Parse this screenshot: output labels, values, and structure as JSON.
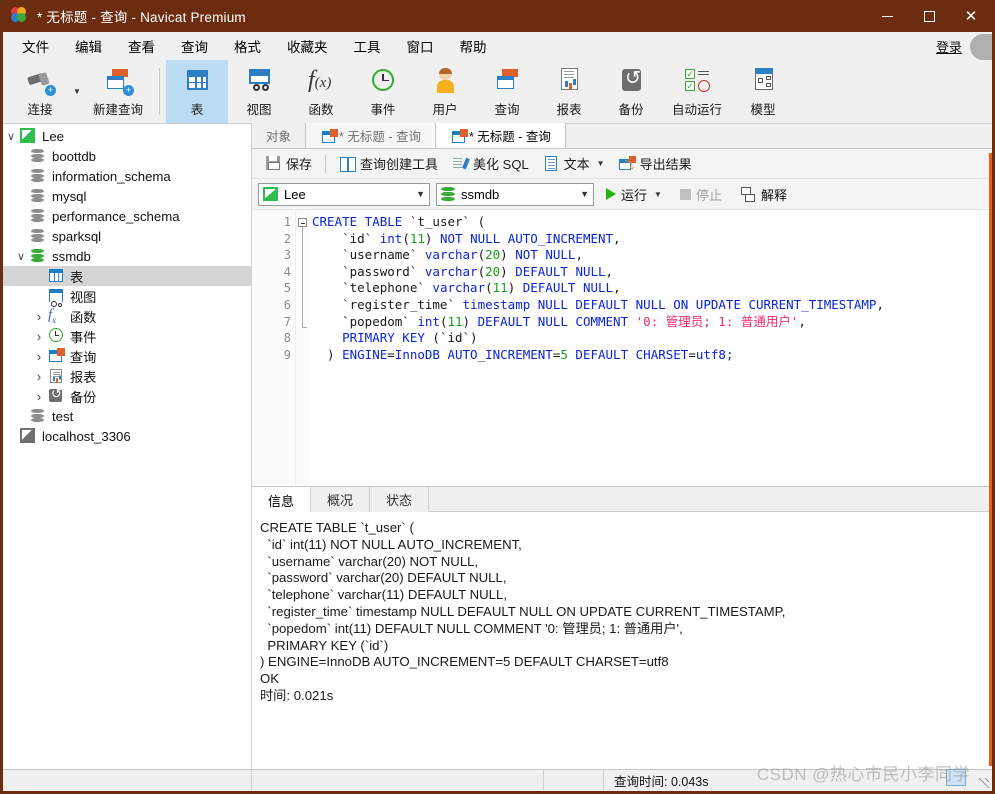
{
  "window": {
    "title": "* 无标题 - 查询 - Navicat Premium",
    "minimize": "–",
    "maximize": "□",
    "close": "✕"
  },
  "menubar": {
    "items": [
      "文件",
      "编辑",
      "查看",
      "查询",
      "格式",
      "收藏夹",
      "工具",
      "窗口",
      "帮助"
    ],
    "login": "登录"
  },
  "toolbar": {
    "items": [
      {
        "label": "连接",
        "icon": "plug-icon",
        "has_dropdown": true
      },
      {
        "label": "新建查询",
        "icon": "new-query-icon",
        "has_dropdown": false
      },
      {
        "label": "表",
        "icon": "table-icon",
        "selected": true
      },
      {
        "label": "视图",
        "icon": "view-icon"
      },
      {
        "label": "函数",
        "icon": "function-icon"
      },
      {
        "label": "事件",
        "icon": "event-clock-icon"
      },
      {
        "label": "用户",
        "icon": "user-icon"
      },
      {
        "label": "查询",
        "icon": "query-doc-icon"
      },
      {
        "label": "报表",
        "icon": "report-icon"
      },
      {
        "label": "备份",
        "icon": "backup-icon"
      },
      {
        "label": "自动运行",
        "icon": "automation-icon"
      },
      {
        "label": "模型",
        "icon": "model-icon"
      }
    ]
  },
  "sidebar": {
    "nodes": [
      {
        "label": "Lee",
        "indent": 0,
        "chevron": "down",
        "icon": "connection-green-icon"
      },
      {
        "label": "boottdb",
        "indent": 1,
        "chevron": "none",
        "icon": "database-gray-icon"
      },
      {
        "label": "information_schema",
        "indent": 1,
        "chevron": "none",
        "icon": "database-gray-icon"
      },
      {
        "label": "mysql",
        "indent": 1,
        "chevron": "none",
        "icon": "database-gray-icon"
      },
      {
        "label": "performance_schema",
        "indent": 1,
        "chevron": "none",
        "icon": "database-gray-icon"
      },
      {
        "label": "sparksql",
        "indent": 1,
        "chevron": "none",
        "icon": "database-gray-icon"
      },
      {
        "label": "ssmdb",
        "indent": 1,
        "chevron": "down",
        "icon": "database-green-icon"
      },
      {
        "label": "表",
        "indent": 2,
        "chevron": "none",
        "icon": "table-icon",
        "selected": true
      },
      {
        "label": "视图",
        "indent": 2,
        "chevron": "none",
        "icon": "view-icon"
      },
      {
        "label": "函数",
        "indent": 2,
        "chevron": "right",
        "icon": "function-icon"
      },
      {
        "label": "事件",
        "indent": 2,
        "chevron": "right",
        "icon": "event-clock-icon"
      },
      {
        "label": "查询",
        "indent": 2,
        "chevron": "right",
        "icon": "query-doc-icon"
      },
      {
        "label": "报表",
        "indent": 2,
        "chevron": "right",
        "icon": "report-icon"
      },
      {
        "label": "备份",
        "indent": 2,
        "chevron": "right",
        "icon": "backup-icon"
      },
      {
        "label": "test",
        "indent": 1,
        "chevron": "none",
        "icon": "database-gray-icon"
      },
      {
        "label": "localhost_3306",
        "indent": 0,
        "chevron": "none",
        "icon": "connection-gray-icon"
      }
    ]
  },
  "tabs": [
    {
      "label": "对象",
      "active": false,
      "has_icon": false
    },
    {
      "label": "* 无标题 - 查询",
      "active": false,
      "has_icon": true
    },
    {
      "label": "* 无标题 - 查询",
      "active": true,
      "has_icon": true
    }
  ],
  "query_toolbar": {
    "save": "保存",
    "query_builder": "查询创建工具",
    "beautify_sql": "美化 SQL",
    "text": "文本",
    "export_result": "导出结果"
  },
  "query_bar": {
    "connection": "Lee",
    "database": "ssmdb",
    "run": "运行",
    "stop": "停止",
    "explain": "解释"
  },
  "editor": {
    "line_numbers": [
      "1",
      "2",
      "3",
      "4",
      "5",
      "6",
      "7",
      "8",
      "9"
    ],
    "lines": [
      [
        {
          "t": "CREATE TABLE ",
          "c": "k"
        },
        {
          "t": "`t_user`",
          "c": "id"
        },
        {
          "t": " (",
          "c": "pl"
        }
      ],
      [
        {
          "t": "    `id` ",
          "c": "id"
        },
        {
          "t": "int",
          "c": "k"
        },
        {
          "t": "(",
          "c": "pl"
        },
        {
          "t": "11",
          "c": "n"
        },
        {
          "t": ") ",
          "c": "pl"
        },
        {
          "t": "NOT NULL AUTO_INCREMENT",
          "c": "k"
        },
        {
          "t": ",",
          "c": "pl"
        }
      ],
      [
        {
          "t": "    `username` ",
          "c": "id"
        },
        {
          "t": "varchar",
          "c": "k"
        },
        {
          "t": "(",
          "c": "pl"
        },
        {
          "t": "20",
          "c": "n"
        },
        {
          "t": ") ",
          "c": "pl"
        },
        {
          "t": "NOT NULL",
          "c": "k"
        },
        {
          "t": ",",
          "c": "pl"
        }
      ],
      [
        {
          "t": "    `password` ",
          "c": "id"
        },
        {
          "t": "varchar",
          "c": "k"
        },
        {
          "t": "(",
          "c": "pl"
        },
        {
          "t": "20",
          "c": "n"
        },
        {
          "t": ") ",
          "c": "pl"
        },
        {
          "t": "DEFAULT NULL",
          "c": "k"
        },
        {
          "t": ",",
          "c": "pl"
        }
      ],
      [
        {
          "t": "    `telephone` ",
          "c": "id"
        },
        {
          "t": "varchar",
          "c": "k"
        },
        {
          "t": "(",
          "c": "pl"
        },
        {
          "t": "11",
          "c": "n"
        },
        {
          "t": ") ",
          "c": "pl"
        },
        {
          "t": "DEFAULT NULL",
          "c": "k"
        },
        {
          "t": ",",
          "c": "pl"
        }
      ],
      [
        {
          "t": "    `register_time` ",
          "c": "id"
        },
        {
          "t": "timestamp NULL DEFAULT NULL ON UPDATE CURRENT_TIMESTAMP",
          "c": "k"
        },
        {
          "t": ",",
          "c": "pl"
        }
      ],
      [
        {
          "t": "    `popedom` ",
          "c": "id"
        },
        {
          "t": "int",
          "c": "k"
        },
        {
          "t": "(",
          "c": "pl"
        },
        {
          "t": "11",
          "c": "n"
        },
        {
          "t": ") ",
          "c": "pl"
        },
        {
          "t": "DEFAULT NULL COMMENT ",
          "c": "k"
        },
        {
          "t": "'0: 管理员; 1: 普通用户'",
          "c": "s"
        },
        {
          "t": ",",
          "c": "pl"
        }
      ],
      [
        {
          "t": "    PRIMARY KEY ",
          "c": "k"
        },
        {
          "t": "(`id`)",
          "c": "id"
        }
      ],
      [
        {
          "t": "  ) ",
          "c": "pl"
        },
        {
          "t": "ENGINE",
          "c": "k"
        },
        {
          "t": "=",
          "c": "pl"
        },
        {
          "t": "InnoDB AUTO_INCREMENT",
          "c": "k"
        },
        {
          "t": "=",
          "c": "pl"
        },
        {
          "t": "5",
          "c": "n"
        },
        {
          "t": " DEFAULT CHARSET",
          "c": "k"
        },
        {
          "t": "=",
          "c": "pl"
        },
        {
          "t": "utf8;",
          "c": "k"
        }
      ]
    ]
  },
  "results": {
    "tabs": [
      {
        "label": "信息",
        "active": true
      },
      {
        "label": "概况",
        "active": false
      },
      {
        "label": "状态",
        "active": false
      }
    ],
    "message_lines": [
      "CREATE TABLE `t_user` (",
      "  `id` int(11) NOT NULL AUTO_INCREMENT,",
      "  `username` varchar(20) NOT NULL,",
      "  `password` varchar(20) DEFAULT NULL,",
      "  `telephone` varchar(11) DEFAULT NULL,",
      "  `register_time` timestamp NULL DEFAULT NULL ON UPDATE CURRENT_TIMESTAMP,",
      "  `popedom` int(11) DEFAULT NULL COMMENT '0: 管理员; 1: 普通用户',",
      "  PRIMARY KEY (`id`)",
      ") ENGINE=InnoDB AUTO_INCREMENT=5 DEFAULT CHARSET=utf8",
      "OK",
      "时间: 0.021s"
    ]
  },
  "statusbar": {
    "query_time": "查询时间: 0.043s"
  },
  "watermark": {
    "text": "CSDN @热心市民小李同学"
  },
  "colors": {
    "titlebar": "#6b2c10",
    "accent_blue": "#2d7fc5",
    "selection": "#bcdcf4",
    "keyword": "#0b24d6",
    "number": "#1a9e1a",
    "string": "#f02a6e",
    "run_green": "#22b512",
    "scroll_orange": "#e85d1a"
  }
}
